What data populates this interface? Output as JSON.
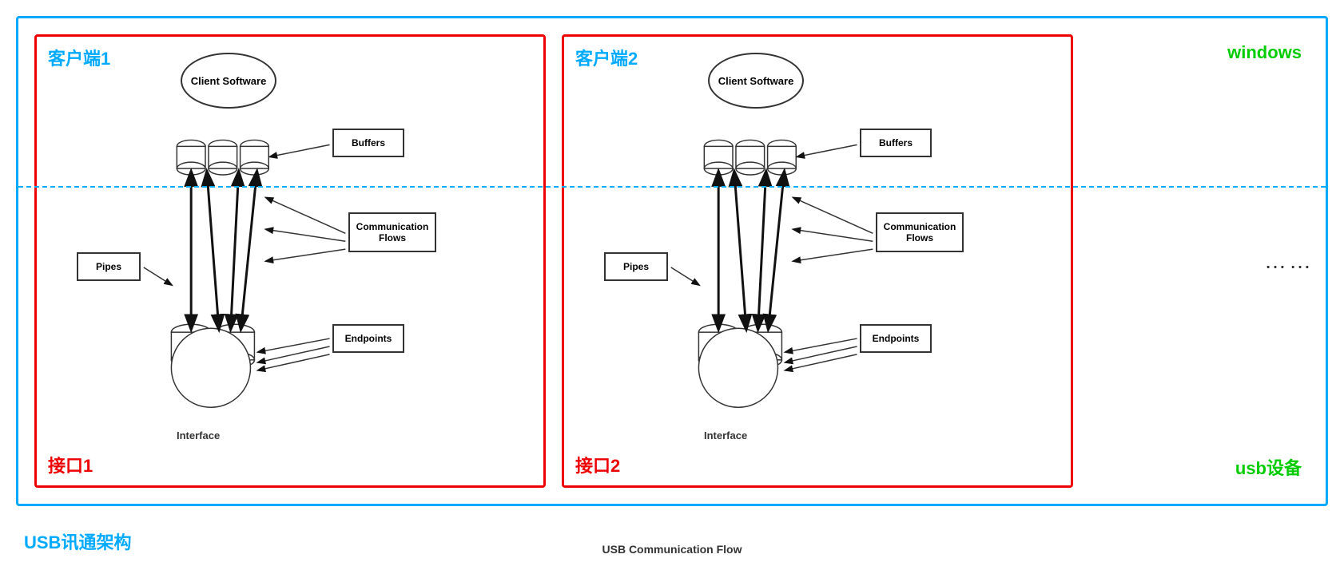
{
  "title": "USB Communication Flow",
  "main_border_color": "#00aaff",
  "client1": {
    "label": "客户端1",
    "interface_label": "接口1",
    "client_software": "Client\nSoftware",
    "buffers": "Buffers",
    "comm_flows": "Communication\nFlows",
    "pipes": "Pipes",
    "endpoints": "Endpoints",
    "interface_text": "Interface"
  },
  "client2": {
    "label": "客户端2",
    "interface_label": "接口2",
    "client_software": "Client\nSoftware",
    "buffers": "Buffers",
    "comm_flows": "Communication\nFlows",
    "pipes": "Pipes",
    "endpoints": "Endpoints",
    "interface_text": "Interface"
  },
  "windows_label": "windows",
  "usb_device_label": "usb设备",
  "dots": "……",
  "usb_arch_label": "USB讯通架构",
  "usb_flow_label": "USB Communication Flow"
}
